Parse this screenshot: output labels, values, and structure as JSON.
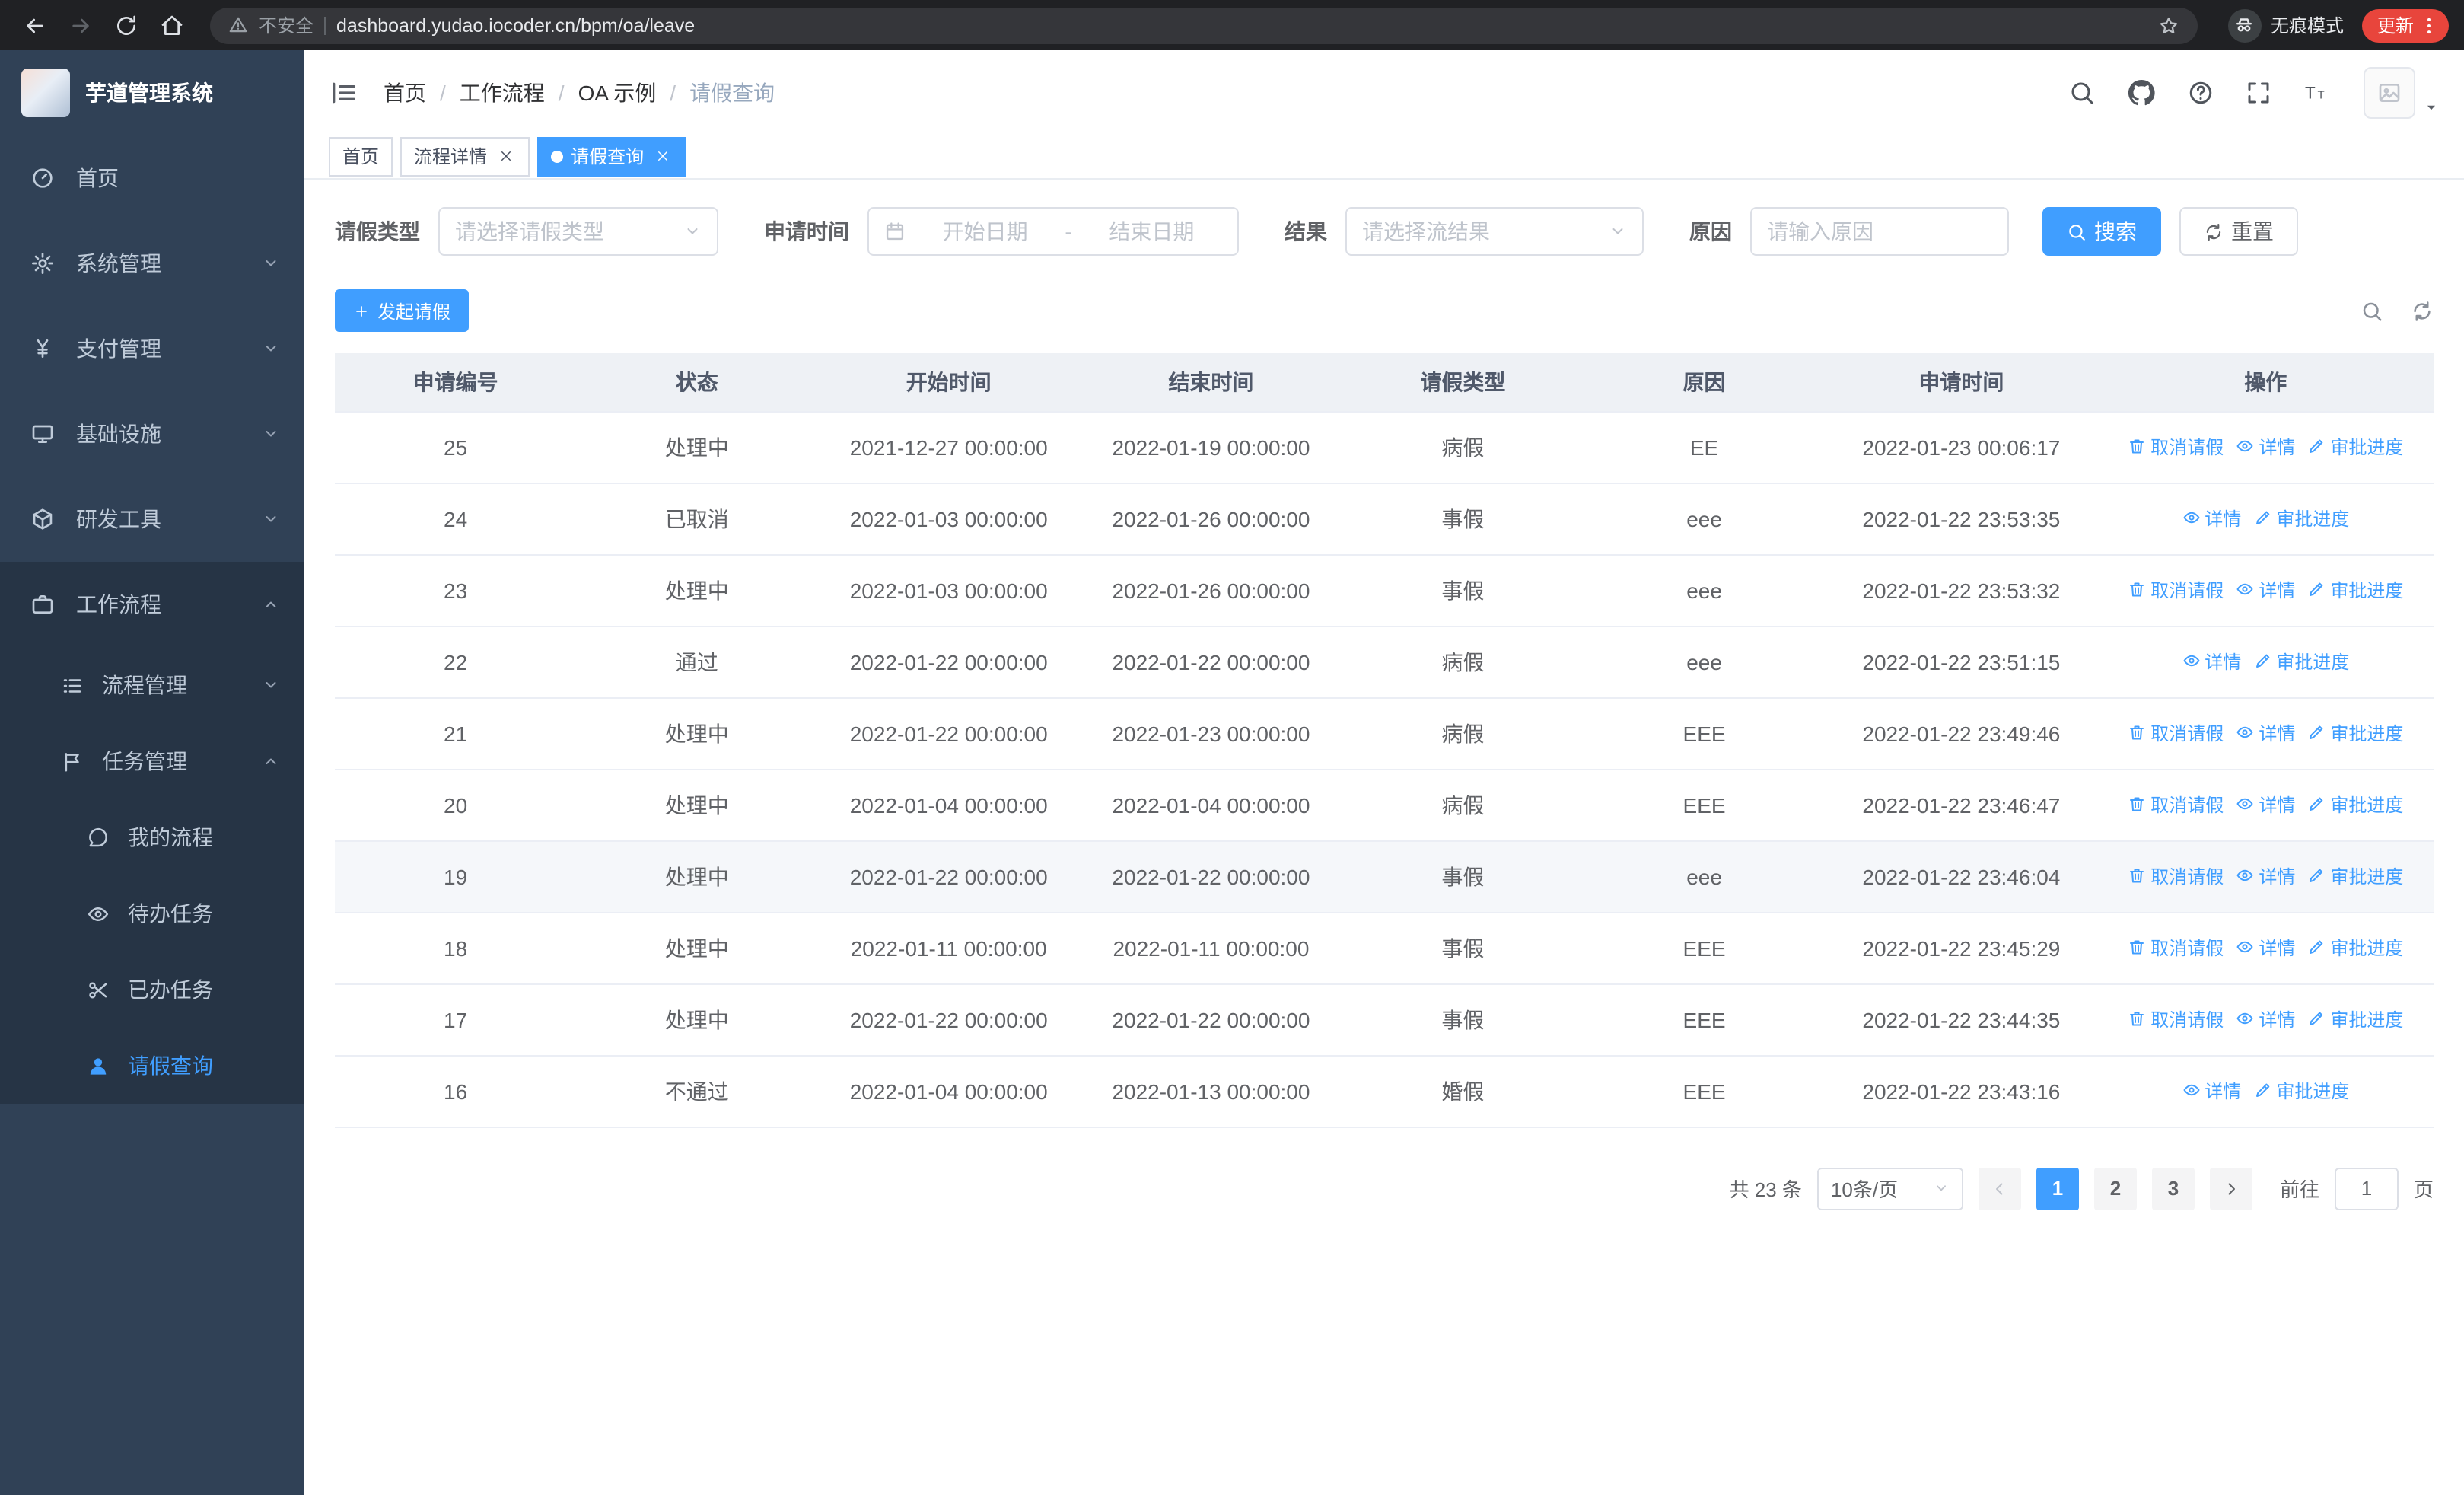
{
  "colors": {
    "primary": "#409eff",
    "sidebar_bg": "#304156",
    "sidebar_sub_bg": "#263445",
    "update_badge": "#e8453c"
  },
  "browser": {
    "security_label": "不安全",
    "url": "dashboard.yudao.iocoder.cn/bpm/oa/leave",
    "incognito_label": "无痕模式",
    "update_label": "更新"
  },
  "app": {
    "logo_title": "芋道管理系统"
  },
  "sidebar": {
    "items": [
      {
        "label": "首页"
      },
      {
        "label": "系统管理"
      },
      {
        "label": "支付管理"
      },
      {
        "label": "基础设施"
      },
      {
        "label": "研发工具"
      },
      {
        "label": "工作流程"
      }
    ],
    "workflow_children": [
      {
        "label": "流程管理"
      },
      {
        "label": "任务管理"
      }
    ],
    "task_children": [
      {
        "label": "我的流程"
      },
      {
        "label": "待办任务"
      },
      {
        "label": "已办任务"
      },
      {
        "label": "请假查询"
      }
    ]
  },
  "header": {
    "breadcrumb": [
      "首页",
      "工作流程",
      "OA 示例",
      "请假查询"
    ],
    "separator": "/"
  },
  "tabs": [
    {
      "label": "首页"
    },
    {
      "label": "流程详情"
    },
    {
      "label": "请假查询"
    }
  ],
  "filters": {
    "leave_type_label": "请假类型",
    "leave_type_placeholder": "请选择请假类型",
    "apply_time_label": "申请时间",
    "start_date_placeholder": "开始日期",
    "date_separator": "-",
    "end_date_placeholder": "结束日期",
    "result_label": "结果",
    "result_placeholder": "请选择流结果",
    "reason_label": "原因",
    "reason_placeholder": "请输入原因",
    "search_button": "搜索",
    "reset_button": "重置"
  },
  "toolbar": {
    "create_button": "发起请假"
  },
  "table": {
    "columns": [
      "申请编号",
      "状态",
      "开始时间",
      "结束时间",
      "请假类型",
      "原因",
      "申请时间",
      "操作"
    ],
    "rows": [
      {
        "id": "25",
        "status": "处理中",
        "start": "2021-12-27 00:00:00",
        "end": "2022-01-19 00:00:00",
        "type": "病假",
        "reason": "EE",
        "apply": "2022-01-23 00:06:17",
        "highlighted": false,
        "actions": [
          {
            "label": "取消请假",
            "icon": "delete",
            "name": "cancel-leave-link"
          },
          {
            "label": "详情",
            "icon": "eye",
            "name": "detail-link"
          },
          {
            "label": "审批进度",
            "icon": "edit",
            "name": "approval-progress-link"
          }
        ]
      },
      {
        "id": "24",
        "status": "已取消",
        "start": "2022-01-03 00:00:00",
        "end": "2022-01-26 00:00:00",
        "type": "事假",
        "reason": "eee",
        "apply": "2022-01-22 23:53:35",
        "highlighted": false,
        "actions": [
          {
            "label": "详情",
            "icon": "eye",
            "name": "detail-link"
          },
          {
            "label": "审批进度",
            "icon": "edit",
            "name": "approval-progress-link"
          }
        ]
      },
      {
        "id": "23",
        "status": "处理中",
        "start": "2022-01-03 00:00:00",
        "end": "2022-01-26 00:00:00",
        "type": "事假",
        "reason": "eee",
        "apply": "2022-01-22 23:53:32",
        "highlighted": false,
        "actions": [
          {
            "label": "取消请假",
            "icon": "delete",
            "name": "cancel-leave-link"
          },
          {
            "label": "详情",
            "icon": "eye",
            "name": "detail-link"
          },
          {
            "label": "审批进度",
            "icon": "edit",
            "name": "approval-progress-link"
          }
        ]
      },
      {
        "id": "22",
        "status": "通过",
        "start": "2022-01-22 00:00:00",
        "end": "2022-01-22 00:00:00",
        "type": "病假",
        "reason": "eee",
        "apply": "2022-01-22 23:51:15",
        "highlighted": false,
        "actions": [
          {
            "label": "详情",
            "icon": "eye",
            "name": "detail-link"
          },
          {
            "label": "审批进度",
            "icon": "edit",
            "name": "approval-progress-link"
          }
        ]
      },
      {
        "id": "21",
        "status": "处理中",
        "start": "2022-01-22 00:00:00",
        "end": "2022-01-23 00:00:00",
        "type": "病假",
        "reason": "EEE",
        "apply": "2022-01-22 23:49:46",
        "highlighted": false,
        "actions": [
          {
            "label": "取消请假",
            "icon": "delete",
            "name": "cancel-leave-link"
          },
          {
            "label": "详情",
            "icon": "eye",
            "name": "detail-link"
          },
          {
            "label": "审批进度",
            "icon": "edit",
            "name": "approval-progress-link"
          }
        ]
      },
      {
        "id": "20",
        "status": "处理中",
        "start": "2022-01-04 00:00:00",
        "end": "2022-01-04 00:00:00",
        "type": "病假",
        "reason": "EEE",
        "apply": "2022-01-22 23:46:47",
        "highlighted": false,
        "actions": [
          {
            "label": "取消请假",
            "icon": "delete",
            "name": "cancel-leave-link"
          },
          {
            "label": "详情",
            "icon": "eye",
            "name": "detail-link"
          },
          {
            "label": "审批进度",
            "icon": "edit",
            "name": "approval-progress-link"
          }
        ]
      },
      {
        "id": "19",
        "status": "处理中",
        "start": "2022-01-22 00:00:00",
        "end": "2022-01-22 00:00:00",
        "type": "事假",
        "reason": "eee",
        "apply": "2022-01-22 23:46:04",
        "highlighted": true,
        "actions": [
          {
            "label": "取消请假",
            "icon": "delete",
            "name": "cancel-leave-link"
          },
          {
            "label": "详情",
            "icon": "eye",
            "name": "detail-link"
          },
          {
            "label": "审批进度",
            "icon": "edit",
            "name": "approval-progress-link"
          }
        ]
      },
      {
        "id": "18",
        "status": "处理中",
        "start": "2022-01-11 00:00:00",
        "end": "2022-01-11 00:00:00",
        "type": "事假",
        "reason": "EEE",
        "apply": "2022-01-22 23:45:29",
        "highlighted": false,
        "actions": [
          {
            "label": "取消请假",
            "icon": "delete",
            "name": "cancel-leave-link"
          },
          {
            "label": "详情",
            "icon": "eye",
            "name": "detail-link"
          },
          {
            "label": "审批进度",
            "icon": "edit",
            "name": "approval-progress-link"
          }
        ]
      },
      {
        "id": "17",
        "status": "处理中",
        "start": "2022-01-22 00:00:00",
        "end": "2022-01-22 00:00:00",
        "type": "事假",
        "reason": "EEE",
        "apply": "2022-01-22 23:44:35",
        "highlighted": false,
        "actions": [
          {
            "label": "取消请假",
            "icon": "delete",
            "name": "cancel-leave-link"
          },
          {
            "label": "详情",
            "icon": "eye",
            "name": "detail-link"
          },
          {
            "label": "审批进度",
            "icon": "edit",
            "name": "approval-progress-link"
          }
        ]
      },
      {
        "id": "16",
        "status": "不通过",
        "start": "2022-01-04 00:00:00",
        "end": "2022-01-13 00:00:00",
        "type": "婚假",
        "reason": "EEE",
        "apply": "2022-01-22 23:43:16",
        "highlighted": false,
        "actions": [
          {
            "label": "详情",
            "icon": "eye",
            "name": "detail-link"
          },
          {
            "label": "审批进度",
            "icon": "edit",
            "name": "approval-progress-link"
          }
        ]
      }
    ]
  },
  "pagination": {
    "total": "共 23 条",
    "page_size": "10条/页",
    "pages": [
      "1",
      "2",
      "3"
    ],
    "goto_label": "前往",
    "goto_value": "1",
    "goto_suffix": "页"
  }
}
